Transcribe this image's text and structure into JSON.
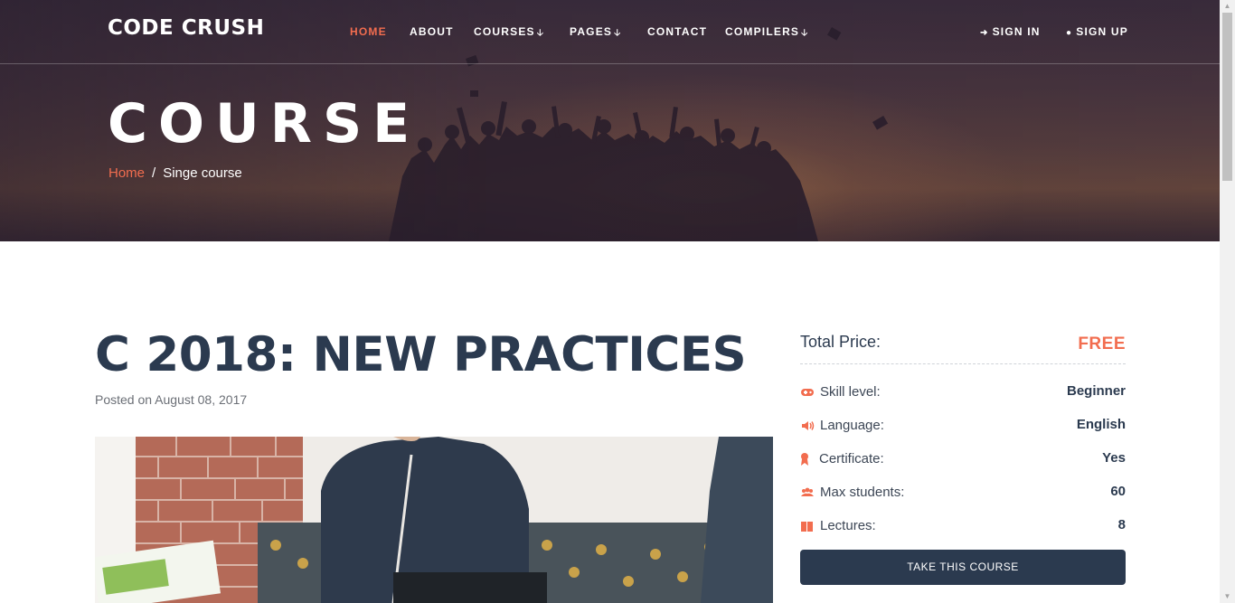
{
  "brand": {
    "logo_text": "CODE CRUSH"
  },
  "nav": {
    "items": [
      {
        "label": "HOME",
        "active": true,
        "dropdown": false
      },
      {
        "label": "ABOUT",
        "active": false,
        "dropdown": false
      },
      {
        "label": "COURSES",
        "active": false,
        "dropdown": true
      },
      {
        "label": "PAGES",
        "active": false,
        "dropdown": true
      },
      {
        "label": "CONTACT",
        "active": false,
        "dropdown": false
      },
      {
        "label": "COMPILERS",
        "active": false,
        "dropdown": true
      }
    ],
    "sign_in": "SIGN IN",
    "sign_up": "SIGN UP"
  },
  "hero": {
    "title": "COURSE",
    "breadcrumb": {
      "home": "Home",
      "separator": "/",
      "current": "Singe course"
    }
  },
  "course": {
    "title": "C 2018: NEW PRACTICES",
    "posted": "Posted on August 08, 2017"
  },
  "sidebar": {
    "price_label": "Total Price:",
    "price_value": "FREE",
    "details": [
      {
        "icon": "gamepad-icon",
        "label": "Skill level:",
        "value": "Beginner"
      },
      {
        "icon": "speaker-icon",
        "label": "Language:",
        "value": "English"
      },
      {
        "icon": "award-icon",
        "label": "Certificate:",
        "value": "Yes"
      },
      {
        "icon": "users-icon",
        "label": "Max students:",
        "value": "60"
      },
      {
        "icon": "book-icon",
        "label": "Lectures:",
        "value": "8"
      }
    ],
    "cta": "TAKE THIS COURSE"
  },
  "colors": {
    "accent": "#f26d4f",
    "navy": "#2b3a4f"
  }
}
